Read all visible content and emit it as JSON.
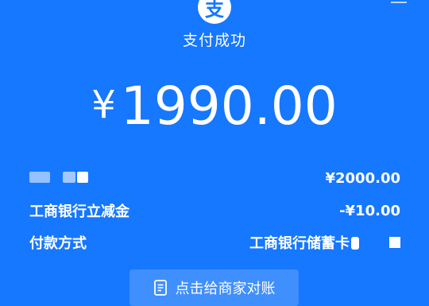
{
  "colors": {
    "background": "#1677ff",
    "text": "#ffffff"
  },
  "icons": {
    "logo": "alipay-logo-icon",
    "share": "document-icon"
  },
  "header": {
    "logo_text": "支"
  },
  "status": "支付成功",
  "amount": {
    "currency": "¥",
    "value": "1990.00"
  },
  "details": [
    {
      "label": "",
      "value": "¥2000.00"
    },
    {
      "label": "工商银行立减金",
      "value": "-¥10.00"
    },
    {
      "label": "付款方式",
      "value": "工商银行储蓄卡"
    }
  ],
  "share_button": {
    "label": "点击给商家对账"
  }
}
